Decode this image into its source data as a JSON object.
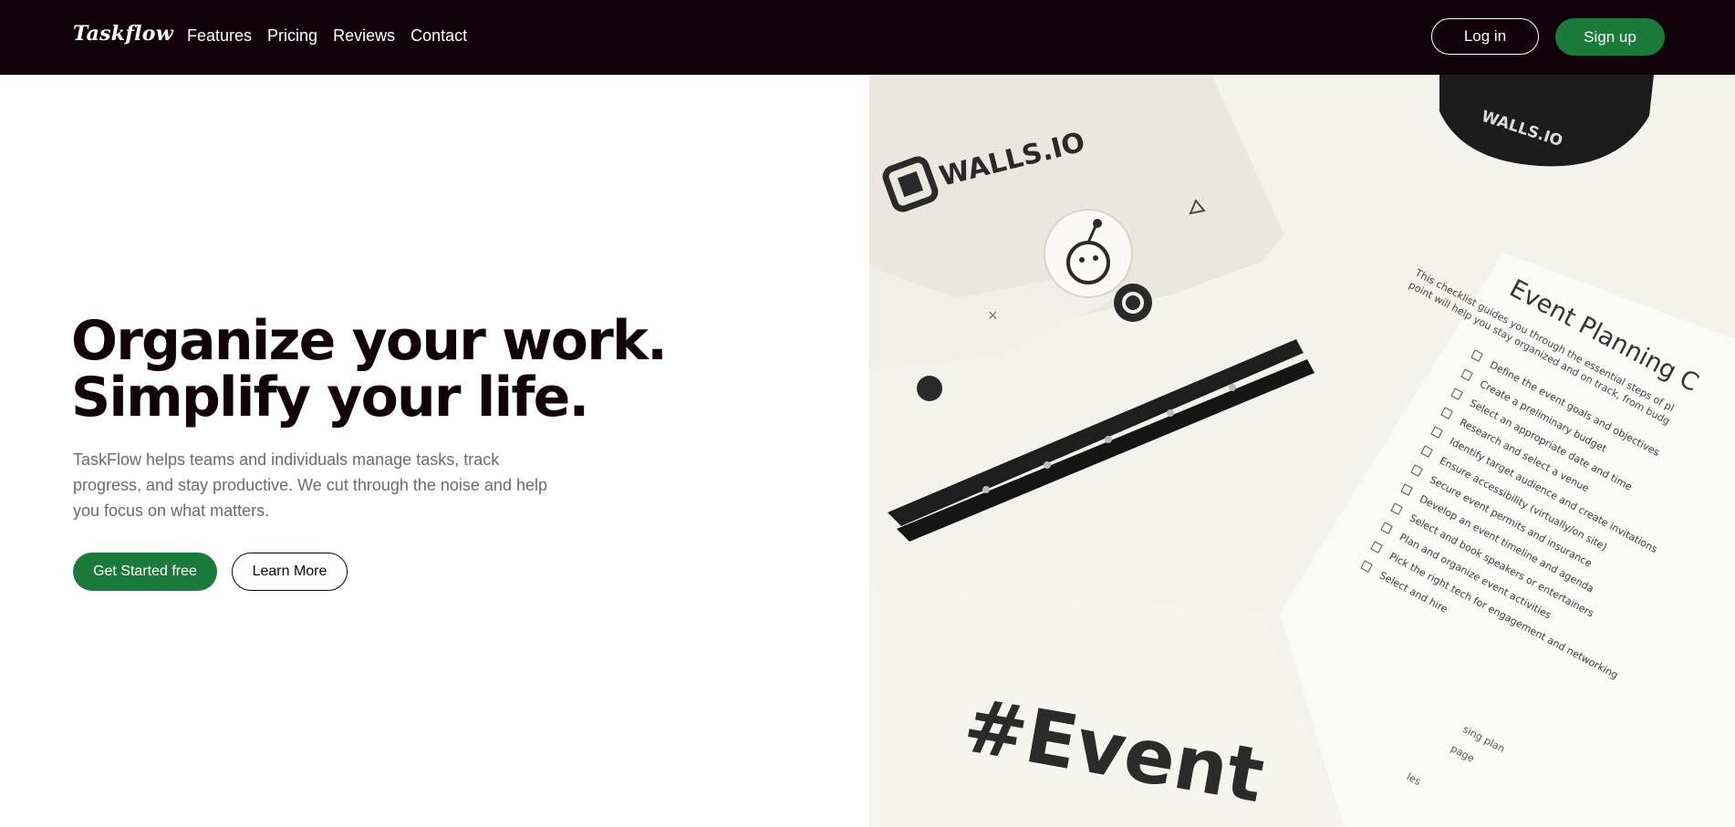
{
  "nav": {
    "logo": "Taskflow",
    "links": [
      "Features",
      "Pricing",
      "Reviews",
      "Contact"
    ],
    "login_label": "Log in",
    "signup_label": "Sign up"
  },
  "hero": {
    "headline_line1": "Organize your work.",
    "headline_line2": "Simplify your life.",
    "description": "TaskFlow helps teams and individuals manage tasks, track progress, and stay productive. We cut through the noise and help you focus on what matters.",
    "primary_cta": "Get Started free",
    "secondary_cta": "Learn More"
  },
  "image": {
    "brand_text": "WALLS.IO",
    "mug_text": "WALLS.IO",
    "doc_title": "Event Planning C",
    "doc_intro_1": "This checklist guides you through the essential steps of pl",
    "doc_intro_2": "point will help you stay organized and on track, from budg",
    "checklist": [
      "Define the event goals and objectives",
      "Create a preliminary budget",
      "Select an appropriate date and time",
      "Research and select a venue",
      "Identify target audience and create invitations",
      "Ensure accessibility (virtually/on site)",
      "Secure event permits and insurance",
      "Develop an event timeline and agenda",
      "Select and book speakers or entertainers",
      "Plan and organize event activities",
      "Pick the right tech for engagement and networking",
      "Select and hire"
    ],
    "doc_fragments": [
      "sing plan",
      "page",
      "les"
    ],
    "event_text": "#Event"
  },
  "colors": {
    "nav_bg": "#120209",
    "accent_green": "#1a7a3a",
    "headline": "#120209",
    "body_text": "#6b6b6b"
  }
}
